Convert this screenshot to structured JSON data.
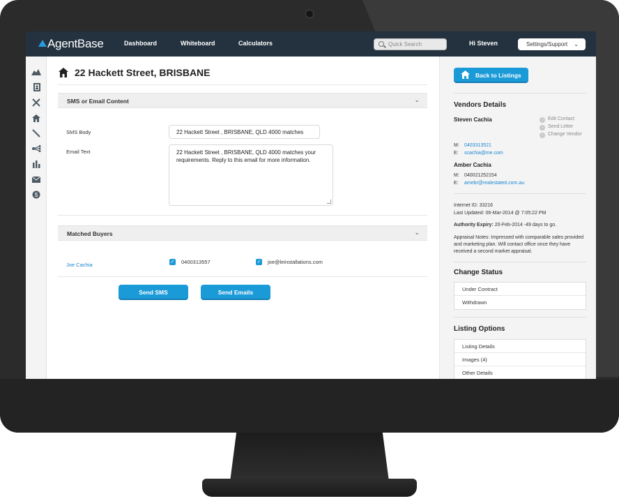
{
  "app": {
    "logo_text": "AgentBase",
    "nav": [
      "Dashboard",
      "Whiteboard",
      "Calculators"
    ],
    "search_placeholder": "Quick Search",
    "greeting": "Hi Steven",
    "settings_label": "Settings/Support"
  },
  "sidebar": {
    "icons": [
      "chart-area-icon",
      "address-book-icon",
      "tools-icon",
      "home-icon",
      "pen-icon",
      "share-icon",
      "bar-chart-icon",
      "mail-icon",
      "dollar-icon"
    ]
  },
  "main": {
    "title": "22 Hackett Street, BRISBANE",
    "sms_section": {
      "title": "SMS or Email Content",
      "sms_label": "SMS Body",
      "sms_value": "22 Hackett Street , BRISBANE, QLD 4000 matches",
      "email_label": "Email Text",
      "email_value": "22 Hackett Street , BRISBANE, QLD 4000 matches your requirements. Reply to this email for more information."
    },
    "buyers_section": {
      "title": "Matched Buyers",
      "buyers": [
        {
          "name": "Joe Cachia",
          "phone": "0400313557",
          "email": "joe@leinstallations.com",
          "phone_checked": true,
          "email_checked": true
        }
      ]
    },
    "buttons": {
      "send_sms": "Send SMS",
      "send_emails": "Send Emails"
    }
  },
  "right": {
    "back_label": "Back to Listings",
    "vendors_title": "Vendors Details",
    "vendors": [
      {
        "name": "Steven Cachia",
        "m_label": "M:",
        "mobile": "0403313521",
        "e_label": "E:",
        "email": "scachia@me.com"
      },
      {
        "name": "Amber Cachia",
        "m_label": "M:",
        "mobile": "040021252154",
        "e_label": "E:",
        "email": "amebr@realestateit.com.au"
      }
    ],
    "vendor_actions": [
      "Edit Contact",
      "Send Letter",
      "Change Vendor"
    ],
    "internet_id": "Internet ID: 33216",
    "last_updated": "Last Updated: 06-Mar-2014 @ 7:05:22 PM",
    "authority_label": "Authority Expiry:",
    "authority_value": "20-Feb-2014 -49 days to go.",
    "notes_lines": [
      "Appraisal Notes: Impressed with comparable sales provided",
      "and marketing plan. Will contact office once they have",
      "received a second market appraisal."
    ],
    "change_status_title": "Change Status",
    "status_options": [
      "Under Contract",
      "Withdrawn"
    ],
    "listing_options_title": "Listing Options",
    "listing_options": [
      "Listing Details",
      "Images (4)",
      "Other Details"
    ]
  }
}
